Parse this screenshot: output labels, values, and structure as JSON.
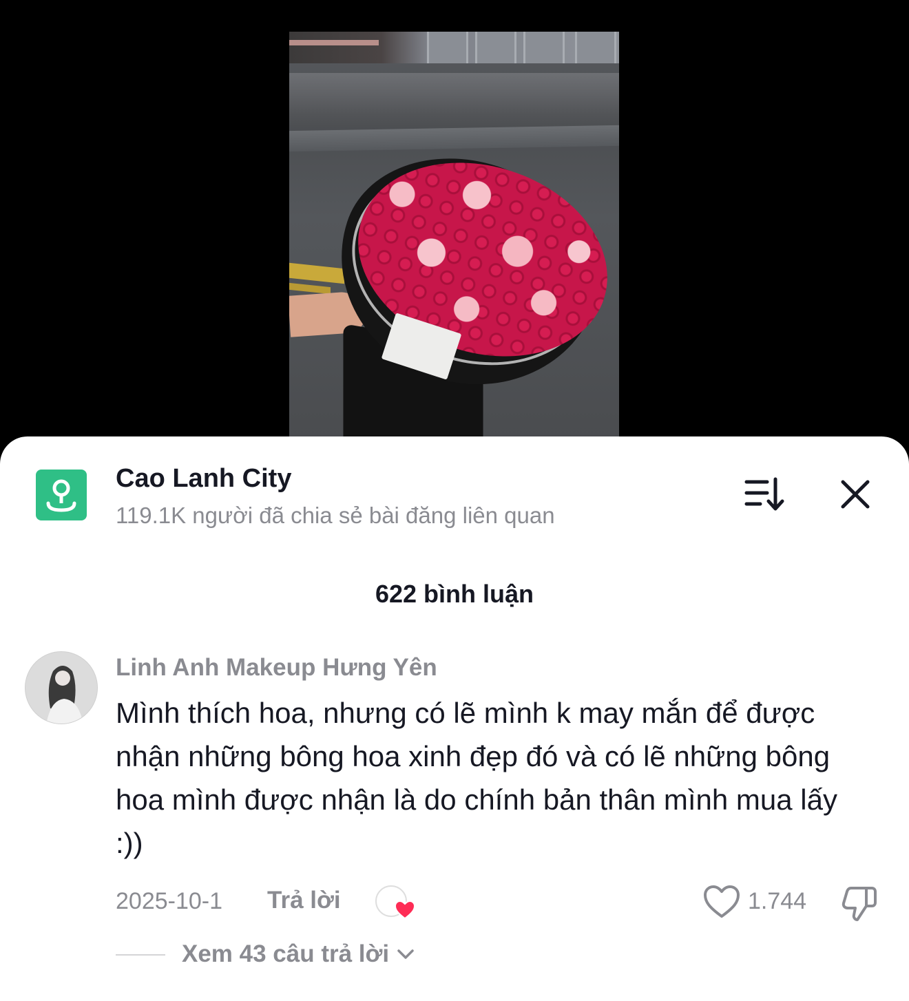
{
  "video": {
    "background": "#000000"
  },
  "header": {
    "location_icon": "location-pin-icon",
    "title": "Cao Lanh City",
    "subtitle": "119.1K người đã chia sẻ bài đăng liên quan",
    "sort_icon": "sort-icon",
    "close_icon": "close-icon",
    "accent_color": "#2fbf86"
  },
  "comments_header": {
    "count_label": "622 bình luận"
  },
  "comment": {
    "author": "Linh Anh Makeup Hưng Yên",
    "text": "Mình thích hoa, nhưng có lẽ mình k may mắn để được nhận những bông hoa xinh đẹp đó và có lẽ những bông hoa mình được nhận là do chính bản thân mình mua lấy :))",
    "date": "2025-10-1",
    "reply_label": "Trả lời",
    "likes": "1.744",
    "creator_liked_color": "#fe2c55",
    "view_replies_label": "Xem 43 câu trả lời"
  }
}
